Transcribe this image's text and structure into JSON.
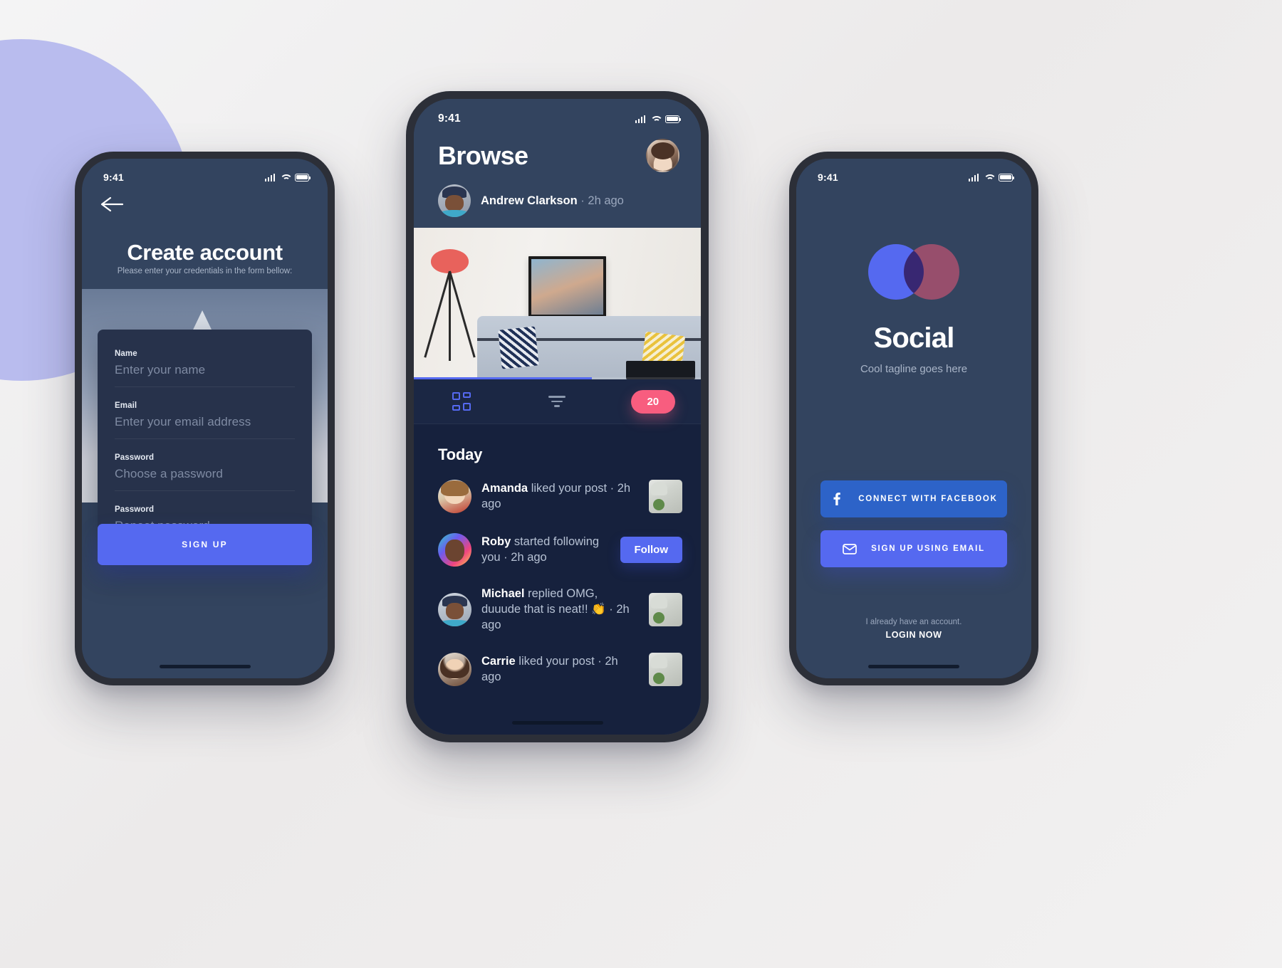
{
  "status_bar": {
    "time": "9:41",
    "icons": [
      "cellular-signal-icon",
      "wifi-icon",
      "battery-icon"
    ]
  },
  "colors": {
    "screen_bg": "#33445f",
    "card_bg": "#27324b",
    "panel_bg": "#16213d",
    "toolbar_bg": "#1b2744",
    "accent_blue": "#5569f0",
    "facebook_blue": "#2d63c8",
    "badge_pink": "#f85d7f",
    "logo_blue": "#5569f0",
    "logo_maroon": "#a04f6e",
    "muted_text": "#9aa7bd"
  },
  "signup_screen": {
    "back_label": "Back",
    "title": "Create account",
    "subtitle": "Please enter your credentials in the form bellow:",
    "fields": [
      {
        "label": "Name",
        "placeholder": "Enter your name",
        "value": ""
      },
      {
        "label": "Email",
        "placeholder": "Enter your email address",
        "value": ""
      },
      {
        "label": "Password",
        "placeholder": "Choose a password",
        "value": ""
      },
      {
        "label": "Password",
        "placeholder": "Repeat password",
        "value": ""
      }
    ],
    "submit_label": "SIGN UP"
  },
  "browse_screen": {
    "title": "Browse",
    "profile_avatar": "user-avatar",
    "post": {
      "author": "Andrew Clarkson",
      "separator": "·",
      "time": "2h ago",
      "image_alt": "living-room-photo",
      "progress_percent": 62
    },
    "toolbar": {
      "grid_icon": "grid-view-icon",
      "filter_icon": "filter-icon",
      "badge_count": "20"
    },
    "section_title": "Today",
    "notifications": [
      {
        "avatar": "amanda",
        "name": "Amanda",
        "action": " liked your post · 2h ago",
        "trailing": "thumb"
      },
      {
        "avatar": "roby",
        "name": "Roby",
        "action": " started following you · 2h ago",
        "trailing": "follow",
        "button_label": "Follow"
      },
      {
        "avatar": "michael",
        "name": "Michael",
        "action": " replied OMG, duuude that is neat!! 👏 · 2h ago",
        "trailing": "thumb"
      },
      {
        "avatar": "carrie",
        "name": "Carrie",
        "action": " liked your post · 2h ago",
        "trailing": "thumb"
      }
    ]
  },
  "social_screen": {
    "logo_alt": "overlapping-circles-logo",
    "title": "Social",
    "tagline": "Cool tagline goes here",
    "facebook_button": {
      "label": "CONNECT WITH FACEBOOK",
      "icon": "facebook-icon"
    },
    "email_button": {
      "label": "SIGN UP USING EMAIL",
      "icon": "envelope-icon"
    },
    "footer_line1": "I already have an account.",
    "footer_line2": "LOGIN NOW"
  }
}
